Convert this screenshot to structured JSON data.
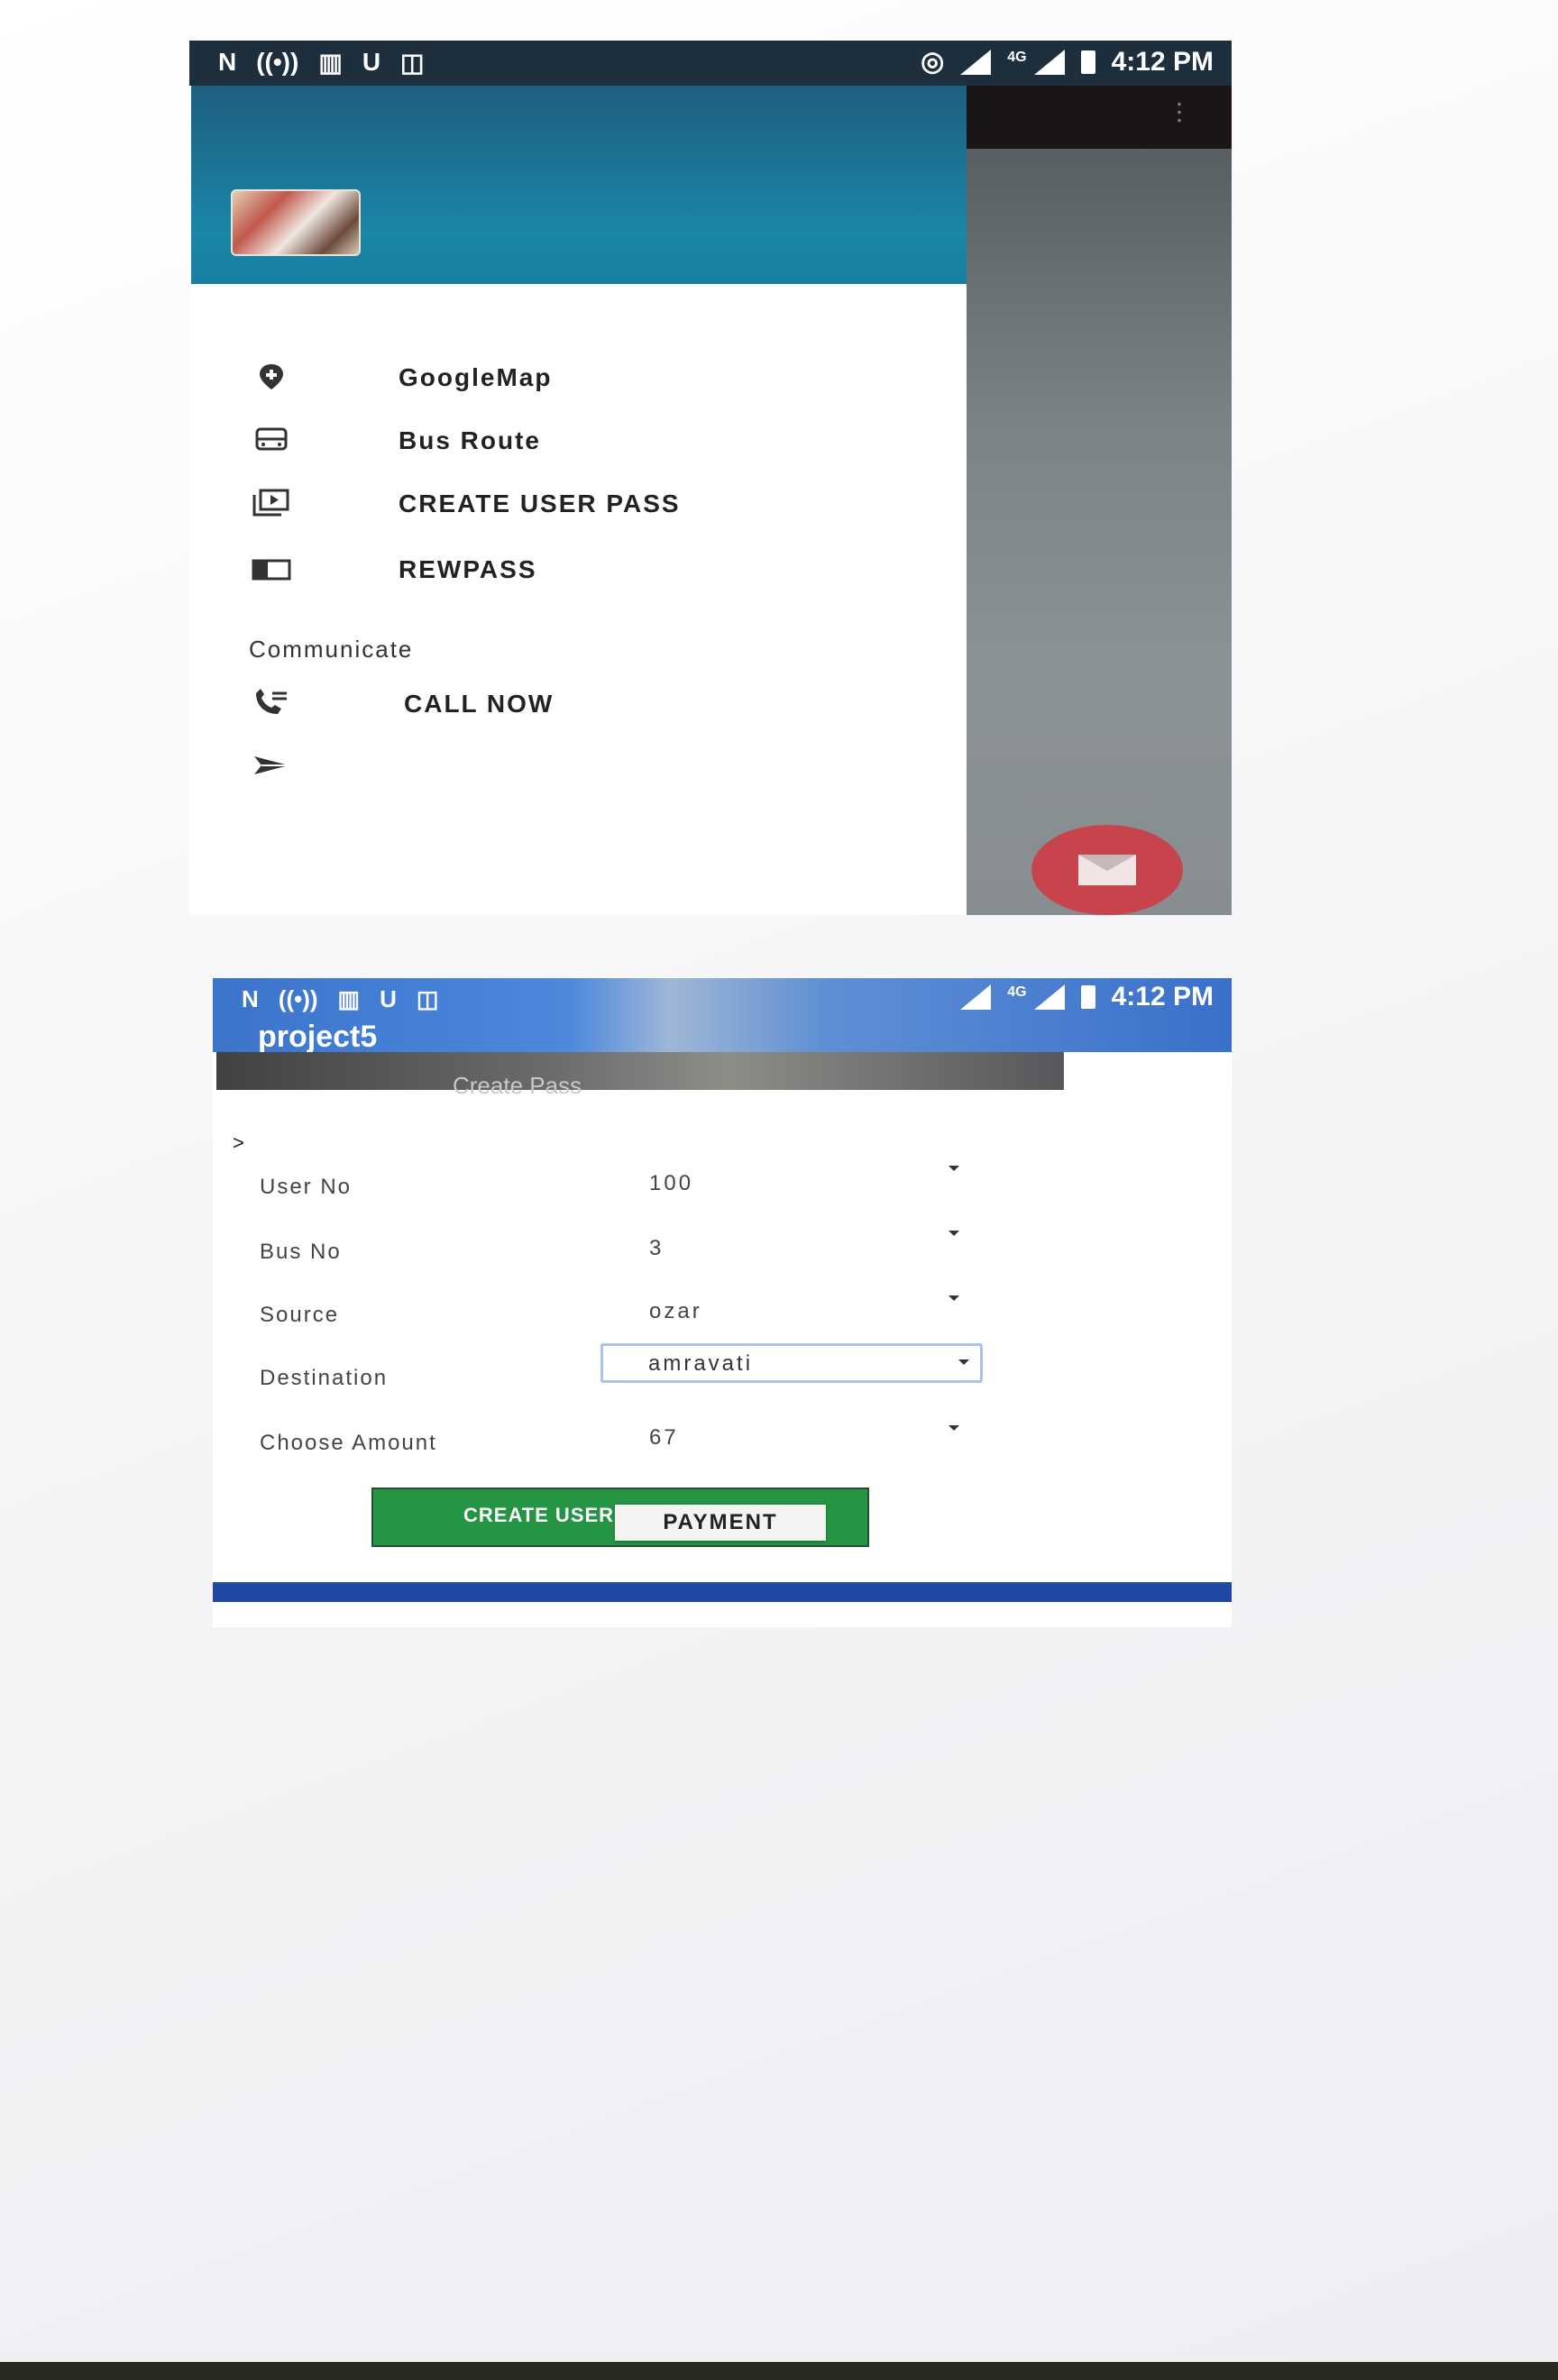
{
  "status_bar": {
    "left_icons": [
      "n-icon",
      "hotspot-icon",
      "book-icon",
      "u-icon",
      "gallery-icon"
    ],
    "right_icons": [
      "nfc-icon",
      "signal-icon",
      "signal-icon",
      "battery-icon"
    ],
    "network": "4G",
    "time": "4:12 PM"
  },
  "drawer": {
    "menu": [
      {
        "icon": "place-icon",
        "label": "GoogleMap"
      },
      {
        "icon": "bus-icon",
        "label": "Bus Route"
      },
      {
        "icon": "slideshow-icon",
        "label": "CREATE USER PASS"
      },
      {
        "icon": "pass-icon",
        "label": "REWPASS"
      }
    ],
    "section_title": "Communicate",
    "communicate": [
      {
        "icon": "phone-icon",
        "label": "CALL NOW"
      },
      {
        "icon": "send-icon",
        "label": ""
      }
    ]
  },
  "fab": {
    "icon": "mail-icon"
  },
  "form_screen": {
    "app_title": "project5",
    "subtitle": "Create Pass",
    "fields": [
      {
        "label": "User No",
        "value": "100"
      },
      {
        "label": "Bus No",
        "value": "3"
      },
      {
        "label": "Source",
        "value": "ozar"
      },
      {
        "label": "Destination",
        "value": "amravati"
      },
      {
        "label": "Choose Amount",
        "value": "67"
      }
    ],
    "create_button": "CREATE USER PASS",
    "payment_label": "PAYMENT"
  },
  "colors": {
    "drawer_header": "#1a86a8",
    "status_bar": "#1d2f3d",
    "app_bar": "#3c74cc",
    "fab": "#c8444d",
    "create_button": "#259443",
    "bottom_bar": "#1e48a4"
  }
}
